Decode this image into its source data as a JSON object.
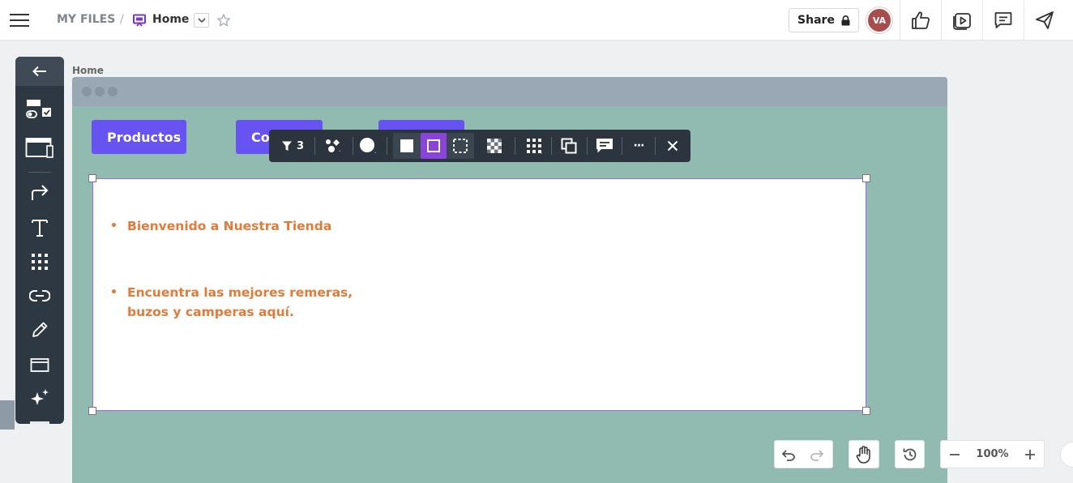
{
  "header": {
    "my_files": "MY FILES",
    "separator": "/",
    "doc_title": "Home",
    "share_label": "Share",
    "avatar_initials": "VA"
  },
  "canvas": {
    "frame_label": "Home",
    "nav_buttons": [
      "Productos",
      "Co"
    ],
    "bullets": [
      "Bienvenido a Nuestra Tienda",
      "Encuentra las mejores remeras,",
      "buzos y camperas aquí."
    ],
    "bullet_color": "#e07b3a",
    "button_color": "#6753f2",
    "frame_color": "#91bbb0"
  },
  "context_toolbar": {
    "filter_count": "3",
    "more_label": "···"
  },
  "left_toolbar": {
    "icons": [
      "back-arrow-icon",
      "components-icon",
      "browser-window-icon",
      "connector-arrow-icon",
      "text-icon",
      "grid-icon",
      "link-icon",
      "pen-icon",
      "frame-icon",
      "magic-sparkle-icon"
    ]
  },
  "bottom_controls": {
    "zoom_level": "100%"
  }
}
